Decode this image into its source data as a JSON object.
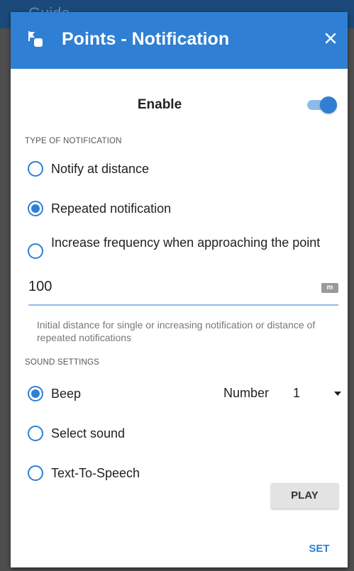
{
  "background": {
    "app_title": "Guide"
  },
  "dialog": {
    "title": "Points - Notification",
    "header_color": "#2f7fd4",
    "icon": "points-icon",
    "close_icon": "close-icon"
  },
  "enable": {
    "label": "Enable",
    "on": true
  },
  "type_section": {
    "header": "TYPE OF NOTIFICATION",
    "options": [
      {
        "label": "Notify at distance",
        "checked": false
      },
      {
        "label": "Repeated notification",
        "checked": true
      },
      {
        "label": "Increase frequency when approaching the point",
        "checked": false
      }
    ]
  },
  "distance": {
    "value": "100",
    "unit": "m",
    "help": "Initial distance for single or increasing notification or distance of repeated notifications"
  },
  "sound_section": {
    "header": "SOUND SETTINGS",
    "options": [
      {
        "label": "Beep",
        "checked": true
      },
      {
        "label": "Select sound",
        "checked": false
      },
      {
        "label": "Text-To-Speech",
        "checked": false
      }
    ],
    "number_label": "Number",
    "number_value": "1"
  },
  "buttons": {
    "play": "PLAY",
    "set": "SET"
  }
}
